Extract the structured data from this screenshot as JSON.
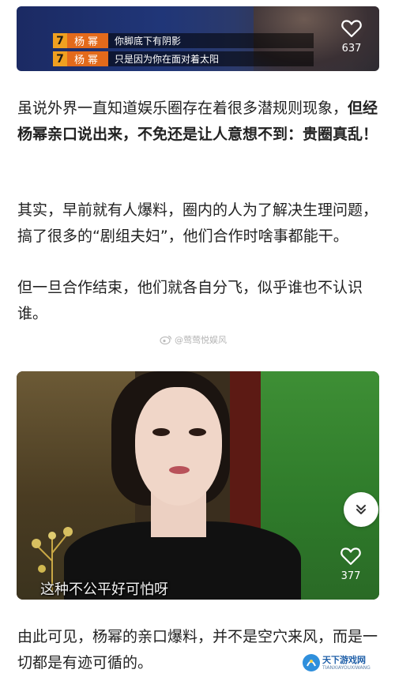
{
  "top_video": {
    "subtitles": [
      {
        "num": "7",
        "name": "杨幂",
        "text": "你脚底下有阴影"
      },
      {
        "num": "7",
        "name": "杨幂",
        "text": "只是因为你在面对着太阳"
      }
    ],
    "like_icon": "heart-outline-icon",
    "like_count": "637"
  },
  "article": {
    "para1_normal": "虽说外界一直知道娱乐圈存在着很多潜规则现象，",
    "para1_bold": "但经杨幂亲口说出来，不免还是让人意想不到：贵圈真乱！",
    "para2": "其实，早前就有人爆料，圈内的人为了解决生理问题，搞了很多的“剧组夫妇”，他们合作时啥事都能干。",
    "para3": "但一旦合作结束，他们就各自分飞，似乎谁也不认识谁。",
    "para4": "由此可见，杨幂的亲口爆料，并不是空穴来风，而是一切都是有迹可循的。"
  },
  "watermark": {
    "icon": "weibo-icon",
    "text": "@莺莺悦娱风"
  },
  "video2": {
    "caption": "这种不公平好可怕呀",
    "like_icon": "heart-outline-icon",
    "like_count": "377",
    "expand_icon": "double-chevron-down-icon"
  },
  "site_logo": {
    "name": "天下游戏网",
    "sub": "TIANXIAYOUXIWANG"
  }
}
